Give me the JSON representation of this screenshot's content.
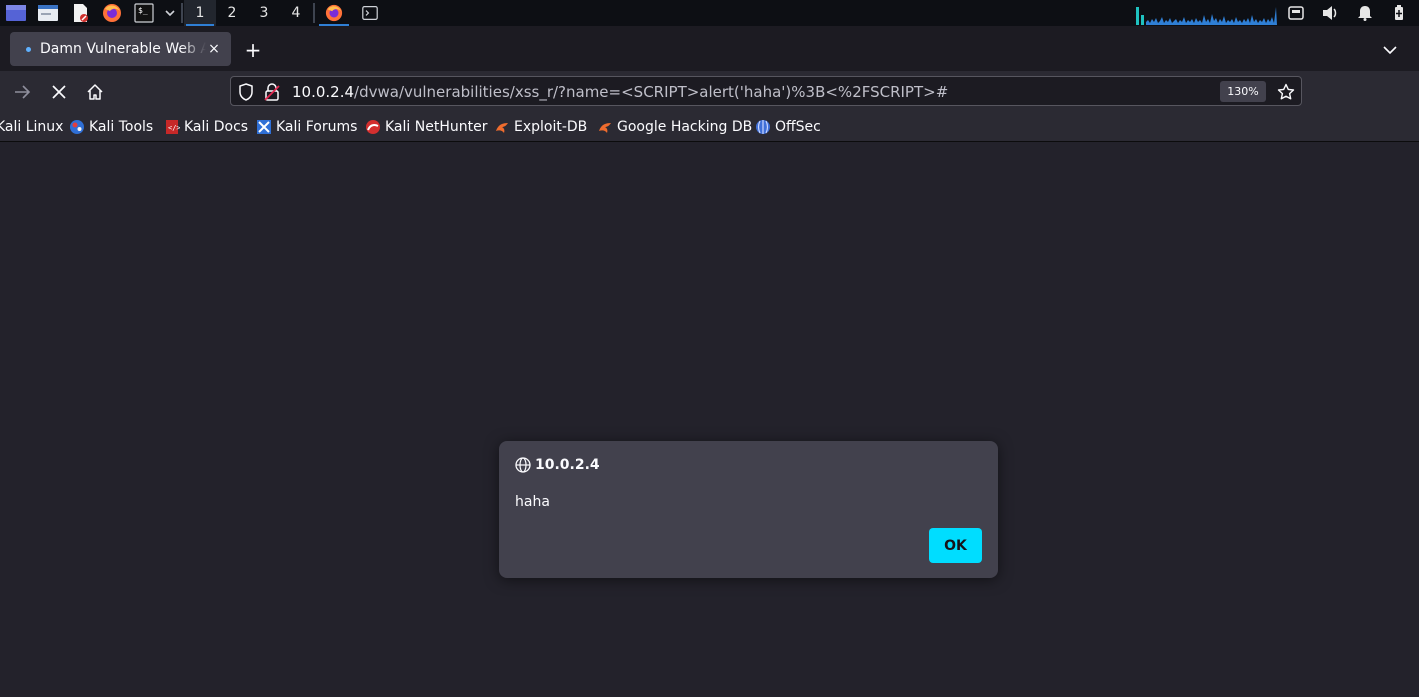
{
  "panel": {
    "workspaces": [
      "1",
      "2",
      "3",
      "4"
    ],
    "active_workspace": "1"
  },
  "browser": {
    "tab": {
      "title": "Damn Vulnerable Web App",
      "close_symbol": "×"
    },
    "new_tab_symbol": "+",
    "url": {
      "host": "10.0.2.4",
      "path": "/dvwa/vulnerabilities/xss_r/?name=<SCRIPT>alert('haha')%3B<%2FSCRIPT>#"
    },
    "zoom": "130%",
    "bookmarks": [
      {
        "label": "Kali Linux",
        "icon": "kali-icon"
      },
      {
        "label": "Kali Tools",
        "icon": "kali-tools-icon"
      },
      {
        "label": "Kali Docs",
        "icon": "kali-docs-icon"
      },
      {
        "label": "Kali Forums",
        "icon": "kali-forums-icon"
      },
      {
        "label": "Kali NetHunter",
        "icon": "nethunter-icon"
      },
      {
        "label": "Exploit-DB",
        "icon": "exploit-db-icon"
      },
      {
        "label": "Google Hacking DB",
        "icon": "ghdb-icon"
      },
      {
        "label": "OffSec",
        "icon": "offsec-icon"
      }
    ]
  },
  "dialog": {
    "host": "10.0.2.4",
    "message": "haha",
    "ok_label": "OK"
  },
  "colors": {
    "accent_button": "#00ddff",
    "dialog_bg": "#42414d",
    "page_bg": "#23222b",
    "panel_active": "#2f7fd5"
  }
}
